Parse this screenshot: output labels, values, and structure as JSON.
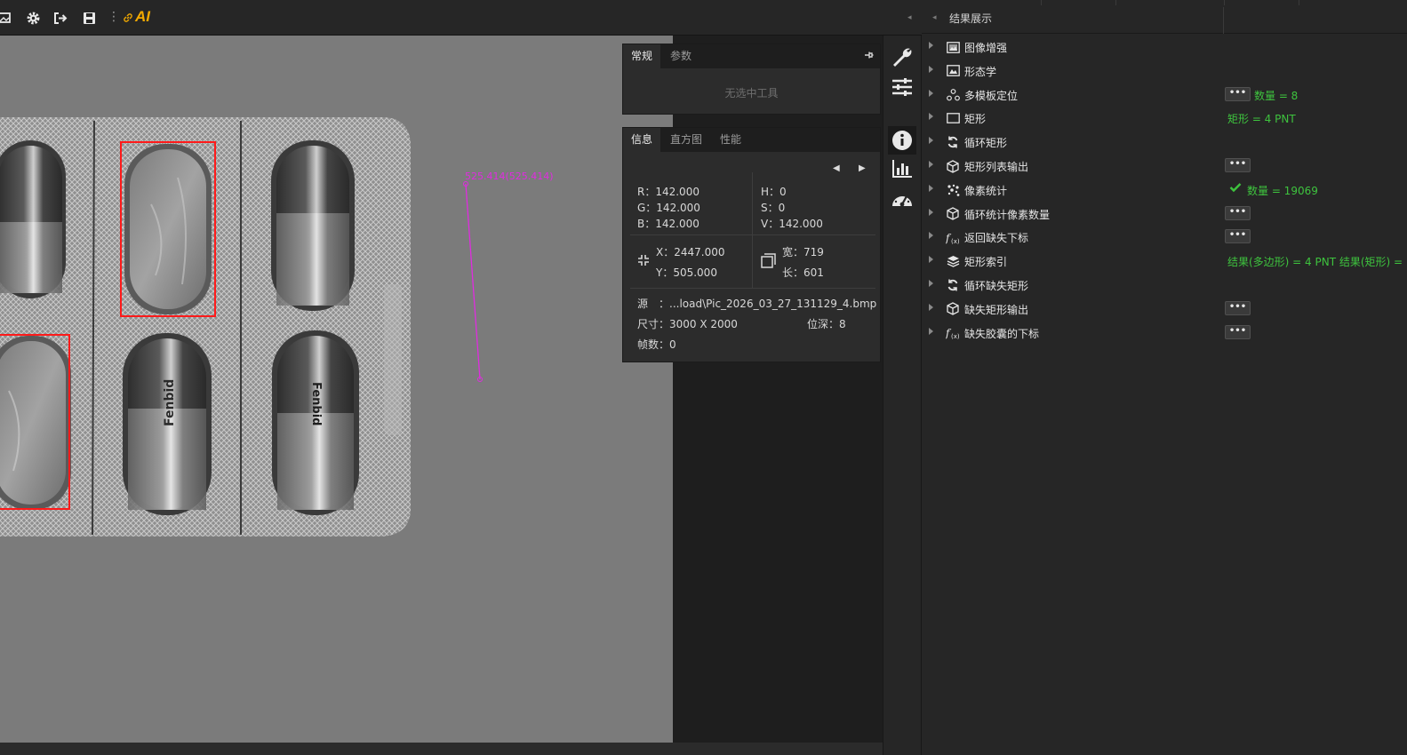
{
  "toolbar": {
    "ai_label": "AI",
    "separator": "⋮"
  },
  "viewer": {
    "measure_label": "525.414(525.414)",
    "blister_text": "Fenbid"
  },
  "tool_panel": {
    "tabs": [
      "常规",
      "参数"
    ],
    "empty_text": "无选中工具"
  },
  "info_panel": {
    "tabs": [
      "信息",
      "直方图",
      "性能"
    ],
    "r": "R：142.000",
    "g": "G：142.000",
    "b": "B：142.000",
    "h": "H：0",
    "s": "S：0",
    "v": "V：142.000",
    "x": "X：2447.000",
    "y": "Y：505.000",
    "width": "宽：719",
    "length": "长：601",
    "source": "源　：...load\\Pic_2026_03_27_131129_4.bmp",
    "size": "尺寸：3000 X 2000",
    "depth": "位深：8",
    "frames": "帧数：0"
  },
  "results": {
    "title": "结果展示",
    "more_label": "•••",
    "items": [
      {
        "label": "图像增强",
        "icon": "image-enhance-icon",
        "more": false,
        "value": ""
      },
      {
        "label": "形态学",
        "icon": "morphology-icon",
        "more": false,
        "value": ""
      },
      {
        "label": "多模板定位",
        "icon": "multi-template-icon",
        "more": true,
        "value": "数量 = 8"
      },
      {
        "label": "矩形",
        "icon": "rectangle-icon",
        "more": false,
        "value": "矩形 = 4 PNT"
      },
      {
        "label": "循环矩形",
        "icon": "loop-icon",
        "more": false,
        "value": ""
      },
      {
        "label": "矩形列表输出",
        "icon": "cube-icon",
        "more": true,
        "value": ""
      },
      {
        "label": "像素统计",
        "icon": "pixel-stats-icon",
        "more": false,
        "value": "数量 = 19069",
        "check": true
      },
      {
        "label": "循环统计像素数量",
        "icon": "cube-icon",
        "more": true,
        "value": ""
      },
      {
        "label": "返回缺失下标",
        "icon": "function-icon",
        "more": true,
        "value": ""
      },
      {
        "label": "矩形索引",
        "icon": "layers-icon",
        "more": false,
        "value": "结果(多边形) = 4 PNT 结果(矩形) ="
      },
      {
        "label": "循环缺失矩形",
        "icon": "loop-icon",
        "more": false,
        "value": ""
      },
      {
        "label": "缺失矩形输出",
        "icon": "cube-icon",
        "more": true,
        "value": ""
      },
      {
        "label": "缺失胶囊的下标",
        "icon": "function-icon",
        "more": true,
        "value": ""
      }
    ]
  }
}
